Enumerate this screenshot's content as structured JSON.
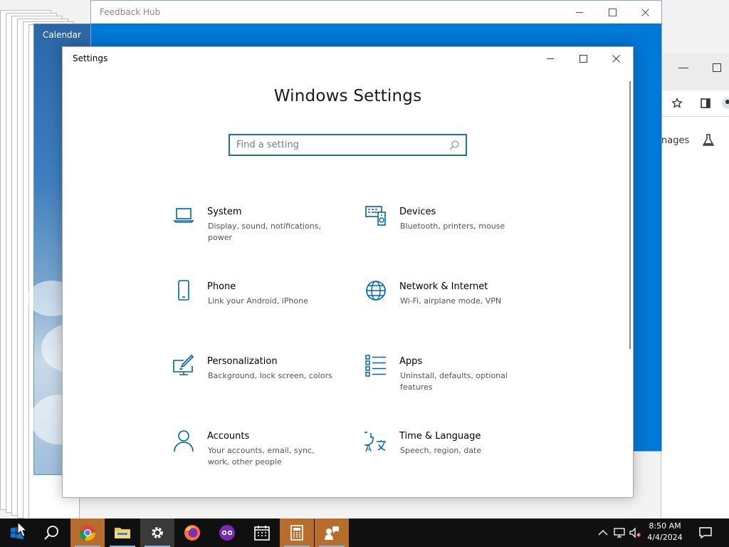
{
  "windows": {
    "calendar_title": "Calendar",
    "feedback_title": "Feedback Hub",
    "settings_title": "Settings",
    "chrome_partial_text": "nages"
  },
  "settings": {
    "heading": "Windows Settings",
    "search_placeholder": "Find a setting",
    "categories": [
      {
        "label": "System",
        "desc": "Display, sound, notifications, power",
        "icon": "laptop-icon"
      },
      {
        "label": "Devices",
        "desc": "Bluetooth, printers, mouse",
        "icon": "devices-icon"
      },
      {
        "label": "Phone",
        "desc": "Link your Android, iPhone",
        "icon": "phone-icon"
      },
      {
        "label": "Network & Internet",
        "desc": "Wi-Fi, airplane mode, VPN",
        "icon": "globe-icon"
      },
      {
        "label": "Personalization",
        "desc": "Background, lock screen, colors",
        "icon": "paint-icon"
      },
      {
        "label": "Apps",
        "desc": "Uninstall, defaults, optional features",
        "icon": "apps-list-icon"
      },
      {
        "label": "Accounts",
        "desc": "Your accounts, email, sync, work, other people",
        "icon": "person-icon"
      },
      {
        "label": "Time & Language",
        "desc": "Speech, region, date",
        "icon": "time-language-icon"
      }
    ]
  },
  "taskbar": {
    "time": "8:50 AM",
    "date": "4/4/2024"
  },
  "colors": {
    "accent": "#0078d7",
    "icon_blue": "#0063b1",
    "taskbar": "#101010"
  }
}
